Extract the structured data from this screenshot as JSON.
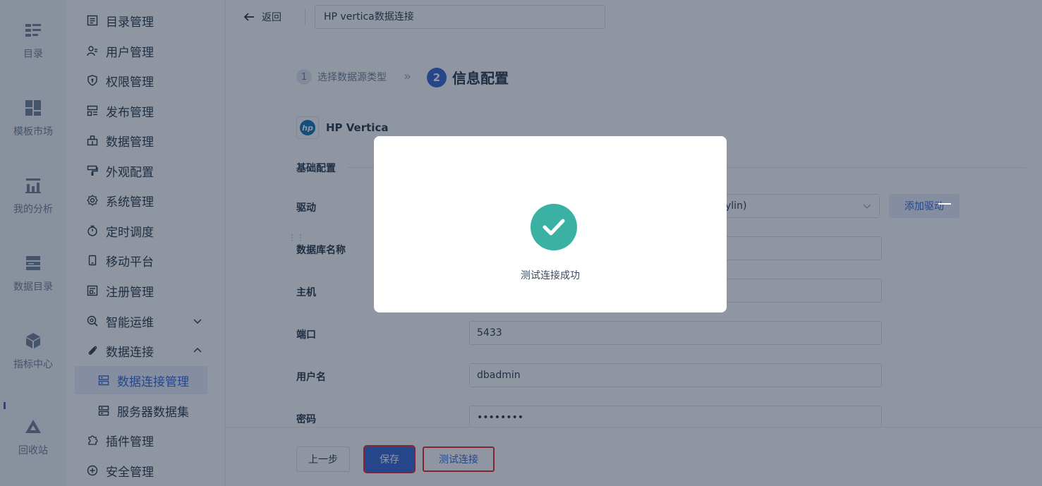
{
  "rail": {
    "items": [
      {
        "label": "目录",
        "icon": "list-icon"
      },
      {
        "label": "模板市场",
        "icon": "grid-icon"
      },
      {
        "label": "我的分析",
        "icon": "chart-icon"
      },
      {
        "label": "数据目录",
        "icon": "database-icon"
      },
      {
        "label": "指标中心",
        "icon": "cube-icon"
      },
      {
        "label": "回收站",
        "icon": "trash-icon"
      }
    ]
  },
  "menu": {
    "items": [
      {
        "label": "目录管理",
        "icon": "catalog-icon"
      },
      {
        "label": "用户管理",
        "icon": "user-icon"
      },
      {
        "label": "权限管理",
        "icon": "shield-icon"
      },
      {
        "label": "发布管理",
        "icon": "publish-icon"
      },
      {
        "label": "数据管理",
        "icon": "data-icon"
      },
      {
        "label": "外观配置",
        "icon": "paint-icon"
      },
      {
        "label": "系统管理",
        "icon": "gear-icon"
      },
      {
        "label": "定时调度",
        "icon": "timer-icon"
      },
      {
        "label": "移动平台",
        "icon": "mobile-icon"
      },
      {
        "label": "注册管理",
        "icon": "register-icon"
      },
      {
        "label": "智能运维",
        "icon": "ops-icon"
      },
      {
        "label": "数据连接",
        "icon": "link-icon"
      },
      {
        "label": "数据连接管理",
        "icon": "server-icon"
      },
      {
        "label": "服务器数据集",
        "icon": "server-dataset-icon"
      },
      {
        "label": "插件管理",
        "icon": "plugin-icon"
      },
      {
        "label": "安全管理",
        "icon": "security-icon"
      }
    ]
  },
  "topbar": {
    "back_label": "返回",
    "title_value": "HP vertica数据连接"
  },
  "steps": {
    "step1_num": "1",
    "step1_label": "选择数据源类型",
    "step2_num": "2",
    "step2_label": "信息配置"
  },
  "datasource": {
    "name": "HP Vertica"
  },
  "form": {
    "section": "基础配置",
    "driver_label": "驱动",
    "driver_value": "ylin)",
    "add_driver_label": "添加驱动",
    "dbname_label": "数据库名称",
    "host_label": "主机",
    "port_label": "端口",
    "port_value": "5433",
    "user_label": "用户名",
    "user_value": "dbadmin",
    "password_label": "密码",
    "password_value": "••••••••"
  },
  "buttons": {
    "prev": "上一步",
    "save": "保存",
    "test": "测试连接"
  },
  "modal": {
    "message": "测试连接成功"
  },
  "colors": {
    "primary": "#2b5fce",
    "success": "#3bb1a3",
    "highlight_border": "#e02020"
  }
}
